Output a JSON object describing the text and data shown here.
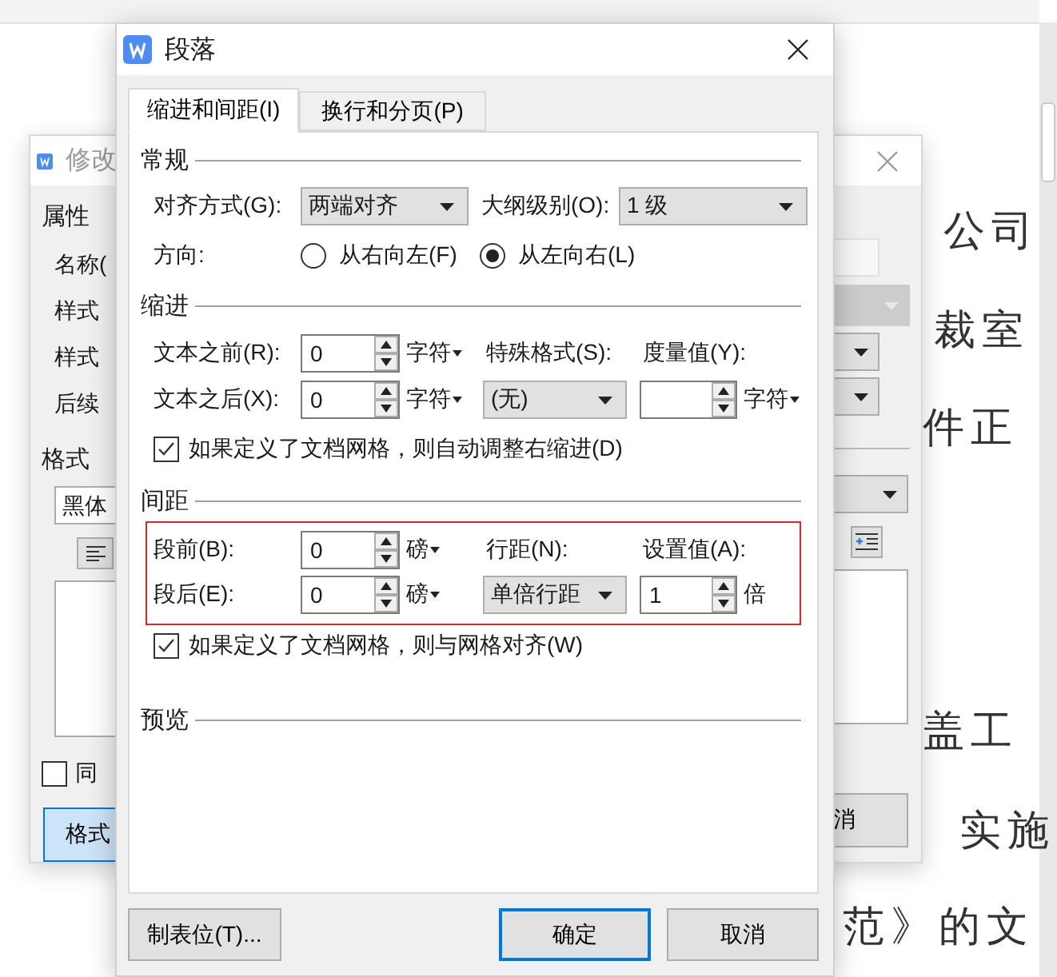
{
  "document": {
    "lines": [
      {
        "text": "公司"
      },
      {
        "text": "裁室"
      },
      {
        "text": "件正"
      },
      {
        "text": "盖工"
      },
      {
        "text": "实施"
      },
      {
        "text": "范》的文"
      }
    ]
  },
  "back_dialog": {
    "title": "修改",
    "section_properties": "属性",
    "field_labels": [
      "名称(",
      "样式",
      "样式",
      "后续"
    ],
    "section_format": "格式",
    "font": "黑体",
    "checkbox": {
      "label": "同",
      "checked": false
    },
    "format_button": "格式",
    "cancel_button": "消"
  },
  "dialog": {
    "title": "段落",
    "tabs": [
      {
        "label": "缩进和间距(I)",
        "selected": true
      },
      {
        "label": "换行和分页(P)",
        "selected": false
      }
    ],
    "general": {
      "heading": "常规",
      "alignment": {
        "label": "对齐方式(G):",
        "value": "两端对齐"
      },
      "outline": {
        "label": "大纲级别(O):",
        "value": "1 级"
      },
      "direction": {
        "label": "方向:",
        "options": [
          {
            "label": "从右向左(F)",
            "selected": false
          },
          {
            "label": "从左向右(L)",
            "selected": true
          }
        ]
      }
    },
    "indent": {
      "heading": "缩进",
      "before": {
        "label": "文本之前(R):",
        "value": "0",
        "unit": "字符"
      },
      "after": {
        "label": "文本之后(X):",
        "value": "0",
        "unit": "字符"
      },
      "special": {
        "label": "特殊格式(S):",
        "value": "(无)"
      },
      "measure": {
        "label": "度量值(Y):",
        "unit": "字符"
      },
      "auto_adjust": {
        "label": "如果定义了文档网格，则自动调整右缩进(D)",
        "checked": true
      }
    },
    "spacing": {
      "heading": "间距",
      "before": {
        "label": "段前(B):",
        "value": "0",
        "unit": "磅"
      },
      "after": {
        "label": "段后(E):",
        "value": "0",
        "unit": "磅"
      },
      "line_spacing": {
        "label": "行距(N):",
        "value": "单倍行距"
      },
      "setting": {
        "label": "设置值(A):",
        "value": "1",
        "unit": "倍"
      },
      "snap_to_grid": {
        "label": "如果定义了文档网格，则与网格对齐(W)",
        "checked": true
      }
    },
    "preview": {
      "heading": "预览"
    },
    "buttons": {
      "tabs": "制表位(T)...",
      "ok": "确定",
      "cancel": "取消"
    }
  }
}
